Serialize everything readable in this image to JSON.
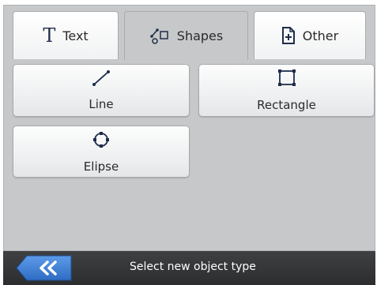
{
  "tabs": [
    {
      "label": "Text",
      "icon": "text-t-icon",
      "active": false
    },
    {
      "label": "Shapes",
      "icon": "shapes-icon",
      "active": true
    },
    {
      "label": "Other",
      "icon": "document-icon",
      "active": false
    }
  ],
  "buttons": {
    "line": {
      "label": "Line",
      "icon": "line-icon"
    },
    "rectangle": {
      "label": "Rectangle",
      "icon": "rectangle-icon"
    },
    "ellipse": {
      "label": "Elipse",
      "icon": "ellipse-icon"
    }
  },
  "bottom_bar": {
    "status": "Select new object type",
    "back_icon": "double-chevron-left-icon"
  },
  "colors": {
    "panel_background": "#c6c8ca",
    "back_button": "#3f7fd6",
    "bottom_bar": "#333537"
  }
}
